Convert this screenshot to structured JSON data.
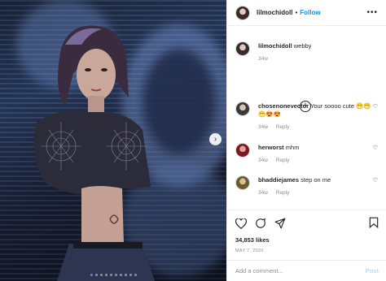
{
  "header": {
    "username": "lilmochidoll",
    "separator": "•",
    "follow_label": "Follow",
    "more_icon": "ellipsis-icon"
  },
  "caption": {
    "username": "lilmochidoll",
    "text": "webby",
    "time": "34w"
  },
  "load_more_icon": "plus-circle-icon",
  "comments": [
    {
      "username": "chosenonevector",
      "text": "Your soooo cute 😁😁😁😍😍",
      "time": "34w",
      "reply_label": "Reply"
    },
    {
      "username": "herworst",
      "text": "mhm",
      "time": "34w",
      "reply_label": "Reply"
    },
    {
      "username": "bhaddiejames",
      "text": "step on me",
      "time": "34w",
      "reply_label": "Reply"
    }
  ],
  "actions": {
    "likes": "34,853 likes",
    "date": "MAY 7, 2020"
  },
  "composer": {
    "placeholder": "Add a comment...",
    "post_label": "Post"
  },
  "carousel": {
    "slide_count": 10,
    "active_index": 0
  },
  "colors": {
    "accent": "#0095f6",
    "post_disabled": "#b2dffc",
    "muted": "#8e8e8e"
  }
}
